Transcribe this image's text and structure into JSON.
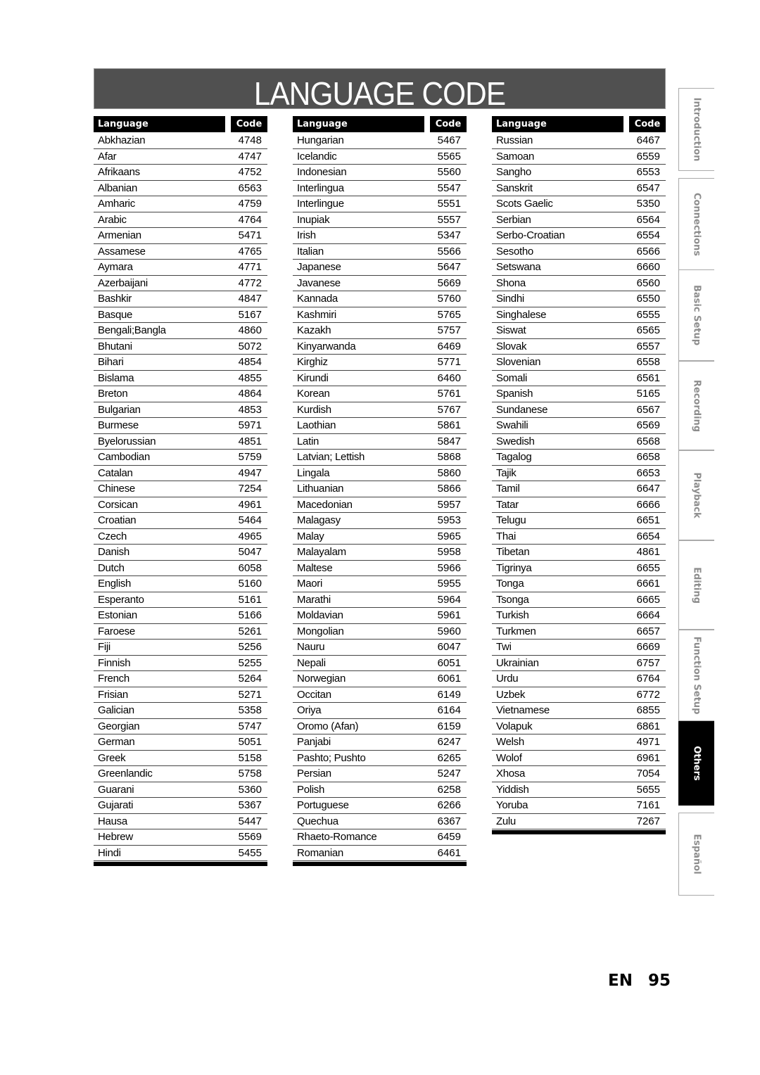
{
  "title": "LANGUAGE CODE",
  "table_header": {
    "language": "Language",
    "code": "Code"
  },
  "columns": [
    [
      [
        "Abkhazian",
        "4748"
      ],
      [
        "Afar",
        "4747"
      ],
      [
        "Afrikaans",
        "4752"
      ],
      [
        "Albanian",
        "6563"
      ],
      [
        "Amharic",
        "4759"
      ],
      [
        "Arabic",
        "4764"
      ],
      [
        "Armenian",
        "5471"
      ],
      [
        "Assamese",
        "4765"
      ],
      [
        "Aymara",
        "4771"
      ],
      [
        "Azerbaijani",
        "4772"
      ],
      [
        "Bashkir",
        "4847"
      ],
      [
        "Basque",
        "5167"
      ],
      [
        "Bengali;Bangla",
        "4860"
      ],
      [
        "Bhutani",
        "5072"
      ],
      [
        "Bihari",
        "4854"
      ],
      [
        "Bislama",
        "4855"
      ],
      [
        "Breton",
        "4864"
      ],
      [
        "Bulgarian",
        "4853"
      ],
      [
        "Burmese",
        "5971"
      ],
      [
        "Byelorussian",
        "4851"
      ],
      [
        "Cambodian",
        "5759"
      ],
      [
        "Catalan",
        "4947"
      ],
      [
        "Chinese",
        "7254"
      ],
      [
        "Corsican",
        "4961"
      ],
      [
        "Croatian",
        "5464"
      ],
      [
        "Czech",
        "4965"
      ],
      [
        "Danish",
        "5047"
      ],
      [
        "Dutch",
        "6058"
      ],
      [
        "English",
        "5160"
      ],
      [
        "Esperanto",
        "5161"
      ],
      [
        "Estonian",
        "5166"
      ],
      [
        "Faroese",
        "5261"
      ],
      [
        "Fiji",
        "5256"
      ],
      [
        "Finnish",
        "5255"
      ],
      [
        "French",
        "5264"
      ],
      [
        "Frisian",
        "5271"
      ],
      [
        "Galician",
        "5358"
      ],
      [
        "Georgian",
        "5747"
      ],
      [
        "German",
        "5051"
      ],
      [
        "Greek",
        "5158"
      ],
      [
        "Greenlandic",
        "5758"
      ],
      [
        "Guarani",
        "5360"
      ],
      [
        "Gujarati",
        "5367"
      ],
      [
        "Hausa",
        "5447"
      ],
      [
        "Hebrew",
        "5569"
      ],
      [
        "Hindi",
        "5455"
      ]
    ],
    [
      [
        "Hungarian",
        "5467"
      ],
      [
        "Icelandic",
        "5565"
      ],
      [
        "Indonesian",
        "5560"
      ],
      [
        "Interlingua",
        "5547"
      ],
      [
        "Interlingue",
        "5551"
      ],
      [
        "Inupiak",
        "5557"
      ],
      [
        "Irish",
        "5347"
      ],
      [
        "Italian",
        "5566"
      ],
      [
        "Japanese",
        "5647"
      ],
      [
        "Javanese",
        "5669"
      ],
      [
        "Kannada",
        "5760"
      ],
      [
        "Kashmiri",
        "5765"
      ],
      [
        "Kazakh",
        "5757"
      ],
      [
        "Kinyarwanda",
        "6469"
      ],
      [
        "Kirghiz",
        "5771"
      ],
      [
        "Kirundi",
        "6460"
      ],
      [
        "Korean",
        "5761"
      ],
      [
        "Kurdish",
        "5767"
      ],
      [
        "Laothian",
        "5861"
      ],
      [
        "Latin",
        "5847"
      ],
      [
        "Latvian; Lettish",
        "5868"
      ],
      [
        "Lingala",
        "5860"
      ],
      [
        "Lithuanian",
        "5866"
      ],
      [
        "Macedonian",
        "5957"
      ],
      [
        "Malagasy",
        "5953"
      ],
      [
        "Malay",
        "5965"
      ],
      [
        "Malayalam",
        "5958"
      ],
      [
        "Maltese",
        "5966"
      ],
      [
        "Maori",
        "5955"
      ],
      [
        "Marathi",
        "5964"
      ],
      [
        "Moldavian",
        "5961"
      ],
      [
        "Mongolian",
        "5960"
      ],
      [
        "Nauru",
        "6047"
      ],
      [
        "Nepali",
        "6051"
      ],
      [
        "Norwegian",
        "6061"
      ],
      [
        "Occitan",
        "6149"
      ],
      [
        "Oriya",
        "6164"
      ],
      [
        "Oromo (Afan)",
        "6159"
      ],
      [
        "Panjabi",
        "6247"
      ],
      [
        "Pashto; Pushto",
        "6265"
      ],
      [
        "Persian",
        "5247"
      ],
      [
        "Polish",
        "6258"
      ],
      [
        "Portuguese",
        "6266"
      ],
      [
        "Quechua",
        "6367"
      ],
      [
        "Rhaeto-Romance",
        "6459"
      ],
      [
        "Romanian",
        "6461"
      ]
    ],
    [
      [
        "Russian",
        "6467"
      ],
      [
        "Samoan",
        "6559"
      ],
      [
        "Sangho",
        "6553"
      ],
      [
        "Sanskrit",
        "6547"
      ],
      [
        "Scots Gaelic",
        "5350"
      ],
      [
        "Serbian",
        "6564"
      ],
      [
        "Serbo-Croatian",
        "6554"
      ],
      [
        "Sesotho",
        "6566"
      ],
      [
        "Setswana",
        "6660"
      ],
      [
        "Shona",
        "6560"
      ],
      [
        "Sindhi",
        "6550"
      ],
      [
        "Singhalese",
        "6555"
      ],
      [
        "Siswat",
        "6565"
      ],
      [
        "Slovak",
        "6557"
      ],
      [
        "Slovenian",
        "6558"
      ],
      [
        "Somali",
        "6561"
      ],
      [
        "Spanish",
        "5165"
      ],
      [
        "Sundanese",
        "6567"
      ],
      [
        "Swahili",
        "6569"
      ],
      [
        "Swedish",
        "6568"
      ],
      [
        "Tagalog",
        "6658"
      ],
      [
        "Tajik",
        "6653"
      ],
      [
        "Tamil",
        "6647"
      ],
      [
        "Tatar",
        "6666"
      ],
      [
        "Telugu",
        "6651"
      ],
      [
        "Thai",
        "6654"
      ],
      [
        "Tibetan",
        "4861"
      ],
      [
        "Tigrinya",
        "6655"
      ],
      [
        "Tonga",
        "6661"
      ],
      [
        "Tsonga",
        "6665"
      ],
      [
        "Turkish",
        "6664"
      ],
      [
        "Turkmen",
        "6657"
      ],
      [
        "Twi",
        "6669"
      ],
      [
        "Ukrainian",
        "6757"
      ],
      [
        "Urdu",
        "6764"
      ],
      [
        "Uzbek",
        "6772"
      ],
      [
        "Vietnamese",
        "6855"
      ],
      [
        "Volapuk",
        "6861"
      ],
      [
        "Welsh",
        "4971"
      ],
      [
        "Wolof",
        "6961"
      ],
      [
        "Xhosa",
        "7054"
      ],
      [
        "Yiddish",
        "5655"
      ],
      [
        "Yoruba",
        "7161"
      ],
      [
        "Zulu",
        "7267"
      ]
    ]
  ],
  "side_tabs": [
    {
      "label": "Introduction",
      "active": false
    },
    {
      "label": "Connections",
      "active": false
    },
    {
      "label": "Basic Setup",
      "active": false
    },
    {
      "label": "Recording",
      "active": false
    },
    {
      "label": "Playback",
      "active": false
    },
    {
      "label": "Editing",
      "active": false
    },
    {
      "label": "Function Setup",
      "active": false
    },
    {
      "label": "Others",
      "active": true
    },
    {
      "label": "Español",
      "active": false
    }
  ],
  "footer": {
    "lang": "EN",
    "page": "95"
  }
}
